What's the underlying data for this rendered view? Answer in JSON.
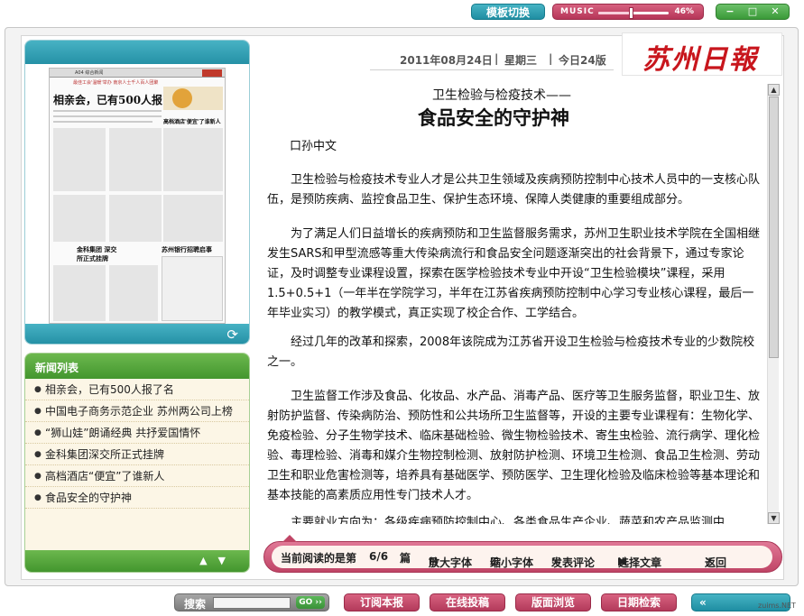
{
  "topbar": {
    "template_switch": "模板切换",
    "music_label": "MUSIC",
    "music_level_pct": 46,
    "music_level_text": "46%"
  },
  "header": {
    "date": "2011年08月24日",
    "weekday": "星期三",
    "pages_today": "今日24版",
    "logo_text": "苏州日報"
  },
  "thumbnail": {
    "section_label": "A04 综合新闻",
    "masthead": "苏州日報",
    "headline": "相亲会，已有500人报了名",
    "kicker": "最佳工会'温暖'举办 南京人士千人百人团聚",
    "sub_headline_1": "金科集团 深交所正式挂牌",
    "sub_headline_2": "苏州银行招聘启事",
    "side_headline": "高档酒店'便宜'了谁新人"
  },
  "news_list": {
    "title": "新闻列表",
    "items": [
      "相亲会，已有500人报了名",
      "中国电子商务示范企业 苏州两公司上榜",
      "“狮山娃”朗诵经典 共抒爱国情怀",
      "金科集团深交所正式挂牌",
      "高档酒店“便宜”了谁新人",
      "食品安全的守护神"
    ]
  },
  "article": {
    "pre_title": "卫生检验与检疫技术——",
    "title": "食品安全的守护神",
    "author": "口孙中文",
    "paragraphs": [
      "卫生检验与检疫技术专业人才是公共卫生领域及疾病预防控制中心技术人员中的一支核心队伍，是预防疾病、监控食品卫生、保护生态环境、保障人类健康的重要组成部分。",
      "为了满足人们日益增长的疾病预防和卫生监督服务需求，苏州卫生职业技术学院在全国相继发生SARS和甲型流感等重大传染病流行和食品安全问题逐渐突出的社会背景下，通过专家论证，及时调整专业课程设置，探索在医学检验技术专业中开设“卫生检验模块”课程，采用1.5+0.5+1（一年半在学院学习，半年在江苏省疾病预防控制中心学习专业核心课程，最后一年毕业实习）的教学模式，真正实现了校企合作、工学结合。",
      "经过几年的改革和探索，2008年该院成为江苏省开设卫生检验与检疫技术专业的少数院校之一。",
      "卫生监督工作涉及食品、化妆品、水产品、消毒产品、医疗等卫生服务监督，职业卫生、放射防护监督、传染病防治、预防性和公共场所卫生监督等，开设的主要专业课程有：生物化学、免疫检验、分子生物学技术、临床基础检验、微生物检验技术、寄生虫检验、流行病学、理化检验、毒理检验、消毒和媒介生物控制检测、放射防护检测、环境卫生检测、食品卫生检测、劳动卫生和职业危害检测等，培养具有基础医学、预防医学、卫生理化检验及临床检验等基本理论和基本技能的高素质应用性专门技术人才。",
      "主要就业方向为：各级疾病预防控制中心、各类食品生产企业、蔬菜和农产品监测中"
    ]
  },
  "reading_bar": {
    "current_label": "当前阅读的是第",
    "current_value": "6/6",
    "unit": "篇",
    "enlarge": "放大字体",
    "shrink": "缩小字体",
    "comment": "发表评论",
    "select": "选择文章",
    "back": "返回"
  },
  "bottom_nav": {
    "search_label": "搜索",
    "go": "GO",
    "subscribe": "订阅本报",
    "submit": "在线投稿",
    "layout_browse": "版面浏览",
    "date_search": "日期检索"
  },
  "watermark": "zuims.NET"
}
